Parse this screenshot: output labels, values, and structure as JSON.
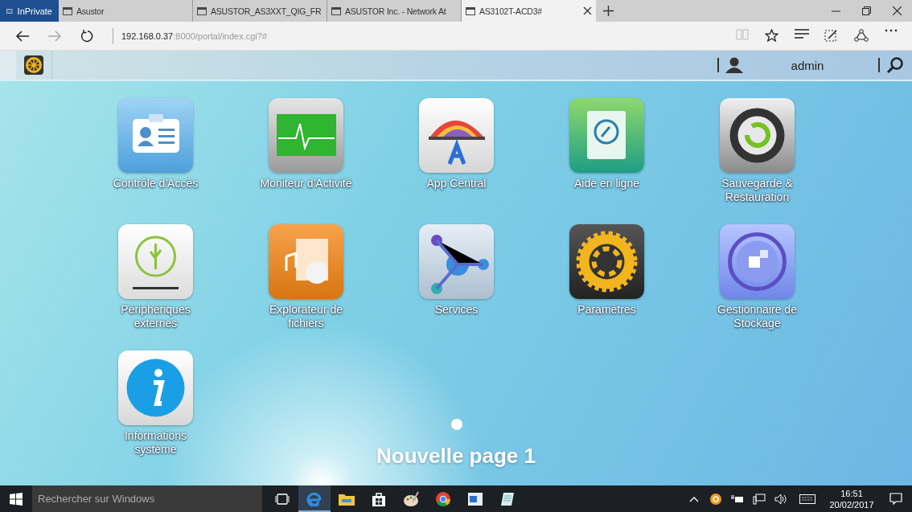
{
  "browser": {
    "private_label": "InPrivate",
    "tabs": [
      {
        "title": "Asustor",
        "selected": false
      },
      {
        "title": "ASUSTOR_AS3XXT_QIG_FR",
        "selected": false
      },
      {
        "title": "ASUSTOR Inc. - Network At",
        "selected": false
      },
      {
        "title": "AS3102T-ACD3#",
        "selected": true
      }
    ],
    "url_host": "192.168.0.37",
    "url_path": ":8000/portal/index.cgi?#"
  },
  "topbar": {
    "user": "admin"
  },
  "apps": [
    {
      "label": "Contrôle d'Accès",
      "kind": "access"
    },
    {
      "label": "Moniteur d'Activité",
      "kind": "monitor"
    },
    {
      "label": "App Central",
      "kind": "appcentral"
    },
    {
      "label": "Aide en ligne",
      "kind": "help"
    },
    {
      "label": "Sauvegarde & Restauration",
      "kind": "backup"
    },
    {
      "label": "Périphériques externes",
      "kind": "usb"
    },
    {
      "label": "Explorateur de fichiers",
      "kind": "files"
    },
    {
      "label": "Services",
      "kind": "services"
    },
    {
      "label": "Paramètres",
      "kind": "settings"
    },
    {
      "label": "Gestionnaire de Stockage",
      "kind": "storage"
    },
    {
      "label": "Informations système",
      "kind": "info"
    }
  ],
  "page_title": "Nouvelle page 1",
  "taskbar": {
    "search_placeholder": "Rechercher sur Windows",
    "time": "16:51",
    "date": "20/02/2017"
  }
}
